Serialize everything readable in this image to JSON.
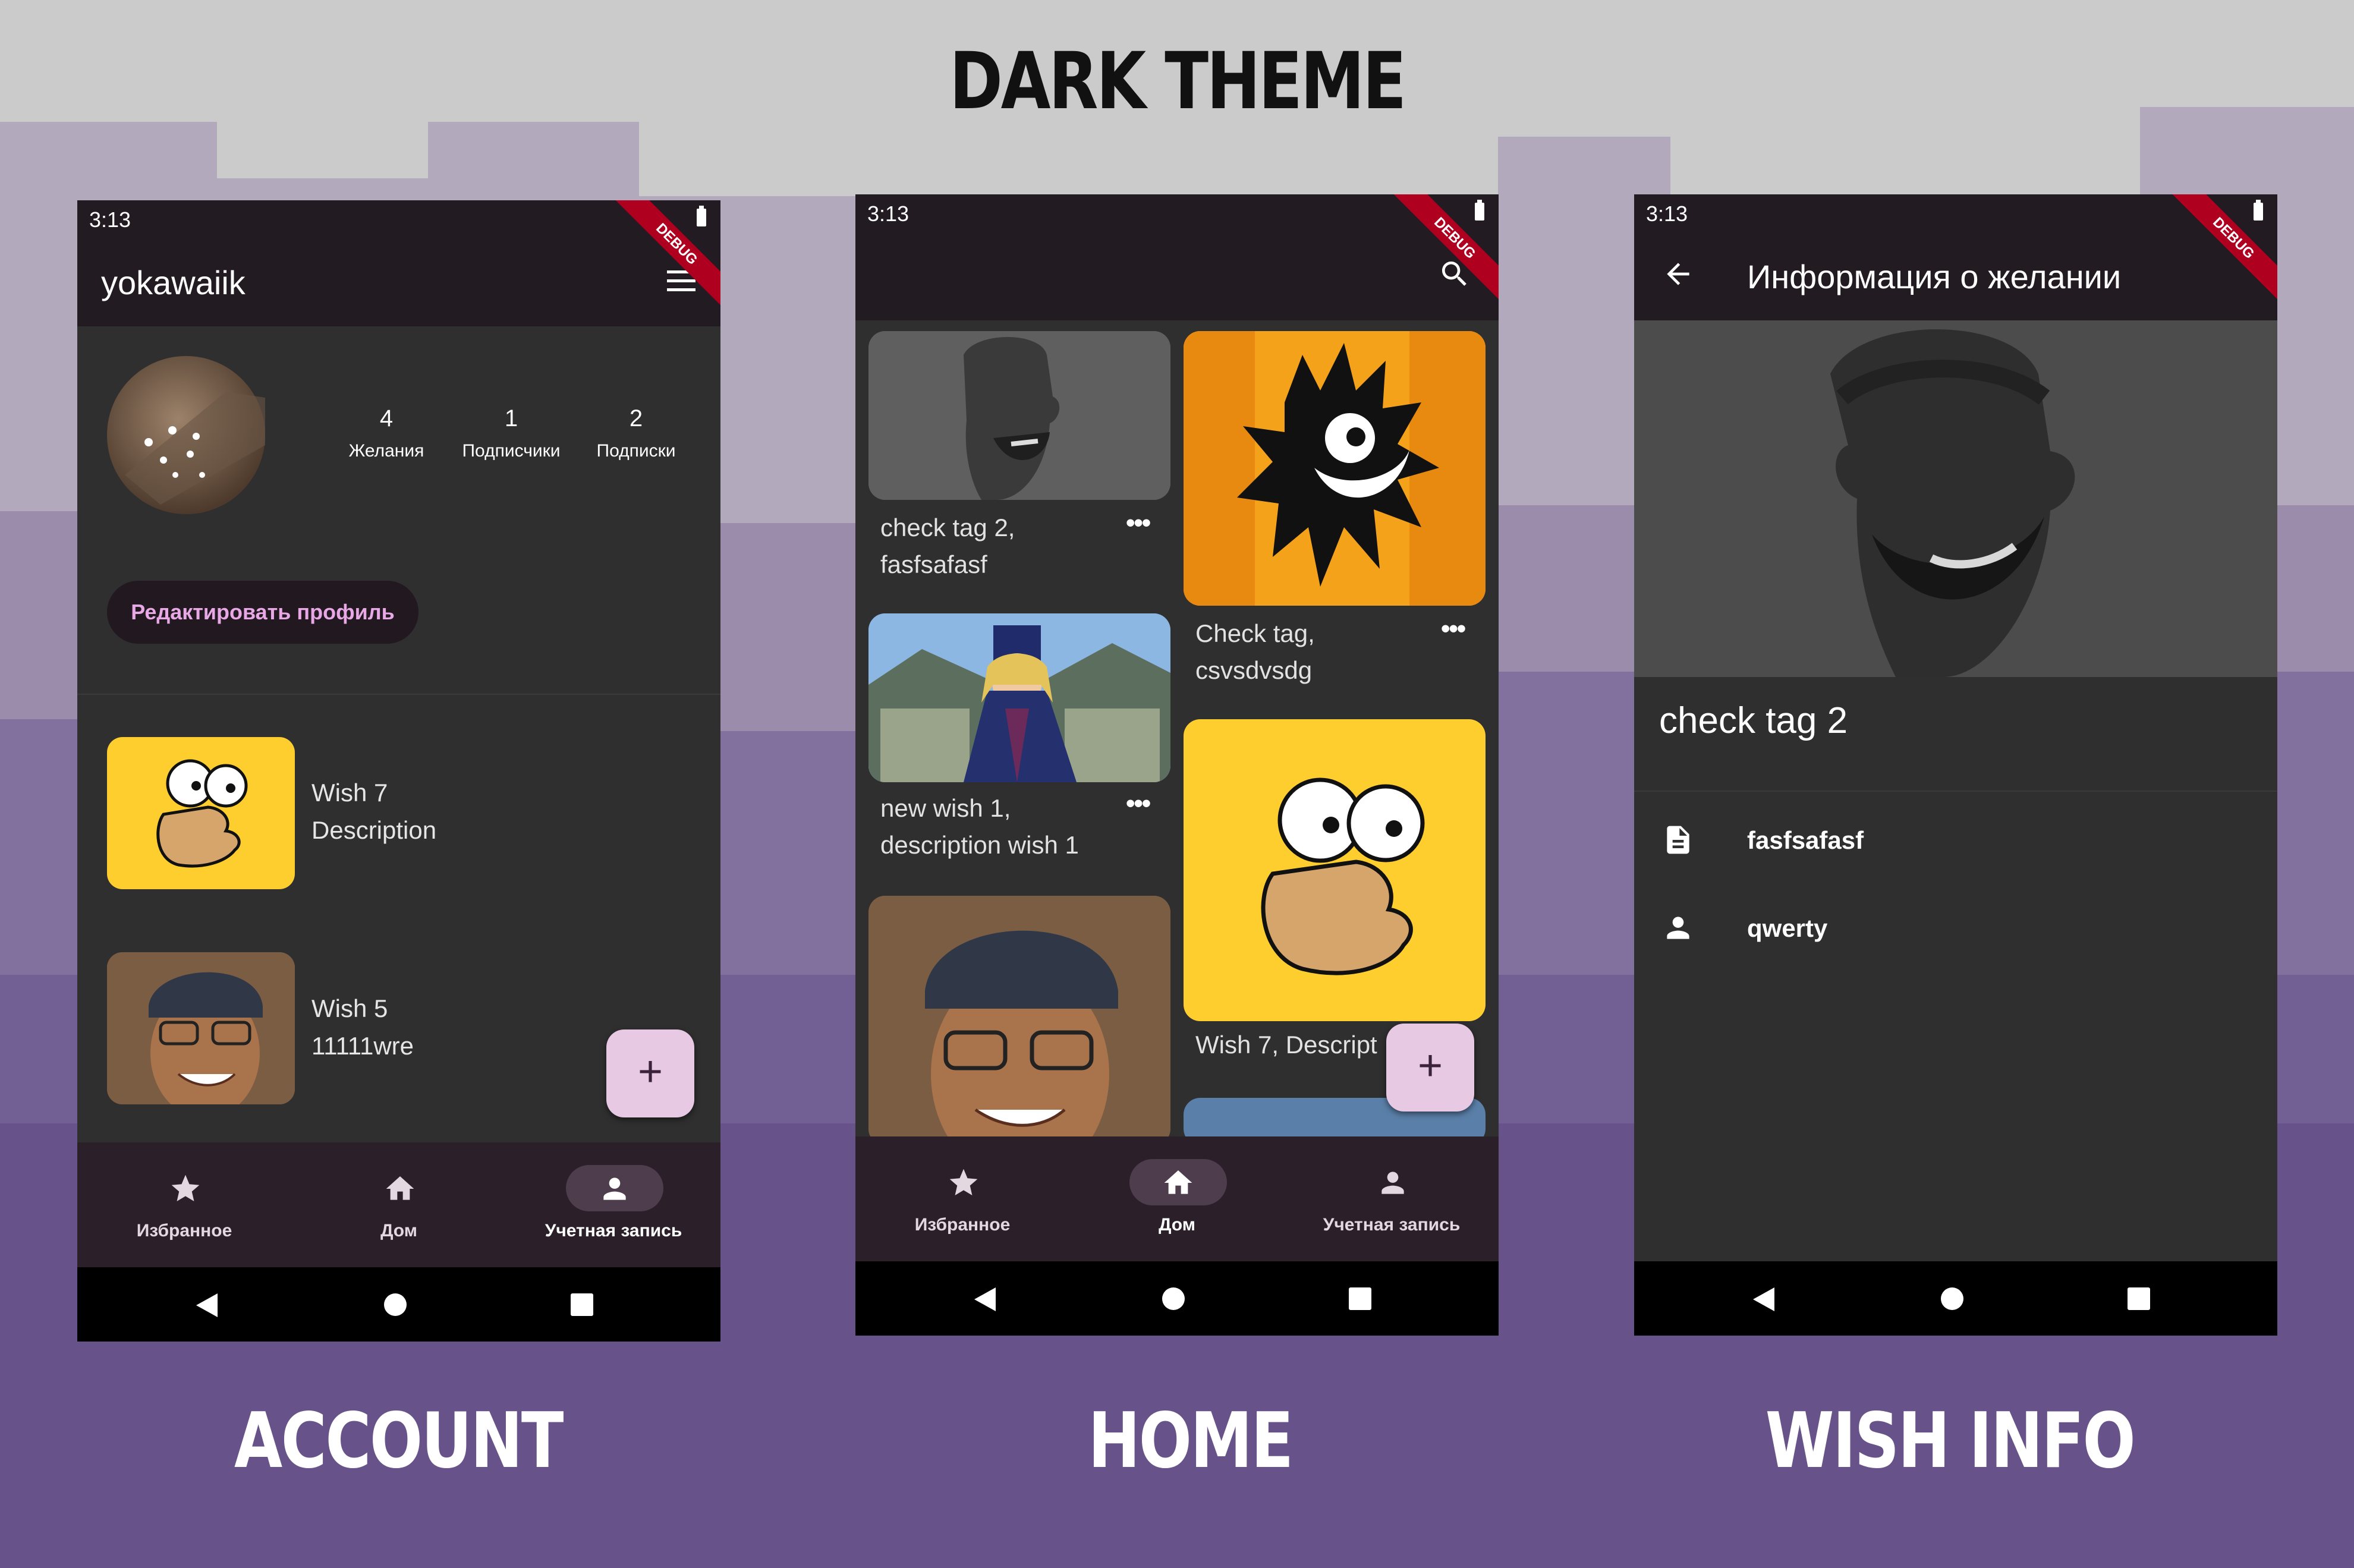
{
  "header": {
    "title": "DARK THEME"
  },
  "captions": {
    "account": "ACCOUNT",
    "home": "HOME",
    "wish_info": "WISH INFO"
  },
  "colors": {
    "bg_light": "#cbcbcb",
    "bg_purple": "#675389",
    "surface": "#2f2f2f",
    "appbar": "#231b22",
    "accent_text": "#e7a8e5",
    "fab": "#e7c9e4",
    "debug_ribbon": "#b00020"
  },
  "account": {
    "status_time": "3:13",
    "debug": "DEBUG",
    "username": "yokawaiik",
    "menu_icon": "menu-icon",
    "stats": [
      {
        "value": "4",
        "label": "Желания"
      },
      {
        "value": "1",
        "label": "Подписчики"
      },
      {
        "value": "2",
        "label": "Подписки"
      }
    ],
    "edit_button": "Редактировать профиль",
    "wishes": [
      {
        "title": "Wish 7",
        "subtitle": "Description",
        "image": "homer-image"
      },
      {
        "title": "Wish 5",
        "subtitle": "11111wre",
        "image": "man-in-cap-image"
      }
    ],
    "fab": "+",
    "nav": [
      {
        "label": "Избранное",
        "icon": "star-icon",
        "active": false
      },
      {
        "label": "Дом",
        "icon": "home-icon",
        "active": false
      },
      {
        "label": "Учетная запись",
        "icon": "person-icon",
        "active": true
      }
    ]
  },
  "home": {
    "status_time": "3:13",
    "debug": "DEBUG",
    "search_icon": "search-icon",
    "cards_left": [
      {
        "line1": "check tag 2,",
        "line2": "fasfsafasf",
        "image": "gigachad-image"
      },
      {
        "line1": "new wish 1,",
        "line2": "description wish 1",
        "image": "anime-character-image"
      },
      {
        "line1": "",
        "line2": "",
        "image": "man-in-cap-image"
      }
    ],
    "cards_right": [
      {
        "line1": "Check tag,",
        "line2": "csvsdvsdg",
        "image": "shadow-creature-image"
      },
      {
        "line1": "Wish 7, Descript",
        "line2": "",
        "image": "homer-image"
      }
    ],
    "fab": "+",
    "nav": [
      {
        "label": "Избранное",
        "icon": "star-icon",
        "active": false
      },
      {
        "label": "Дом",
        "icon": "home-icon",
        "active": true
      },
      {
        "label": "Учетная запись",
        "icon": "person-icon",
        "active": false
      }
    ]
  },
  "wish_info": {
    "status_time": "3:13",
    "debug": "DEBUG",
    "title": "Информация о желании",
    "image": "gigachad-image",
    "wish_name": "check tag 2",
    "description": "fasfsafasf",
    "owner": "qwerty"
  }
}
